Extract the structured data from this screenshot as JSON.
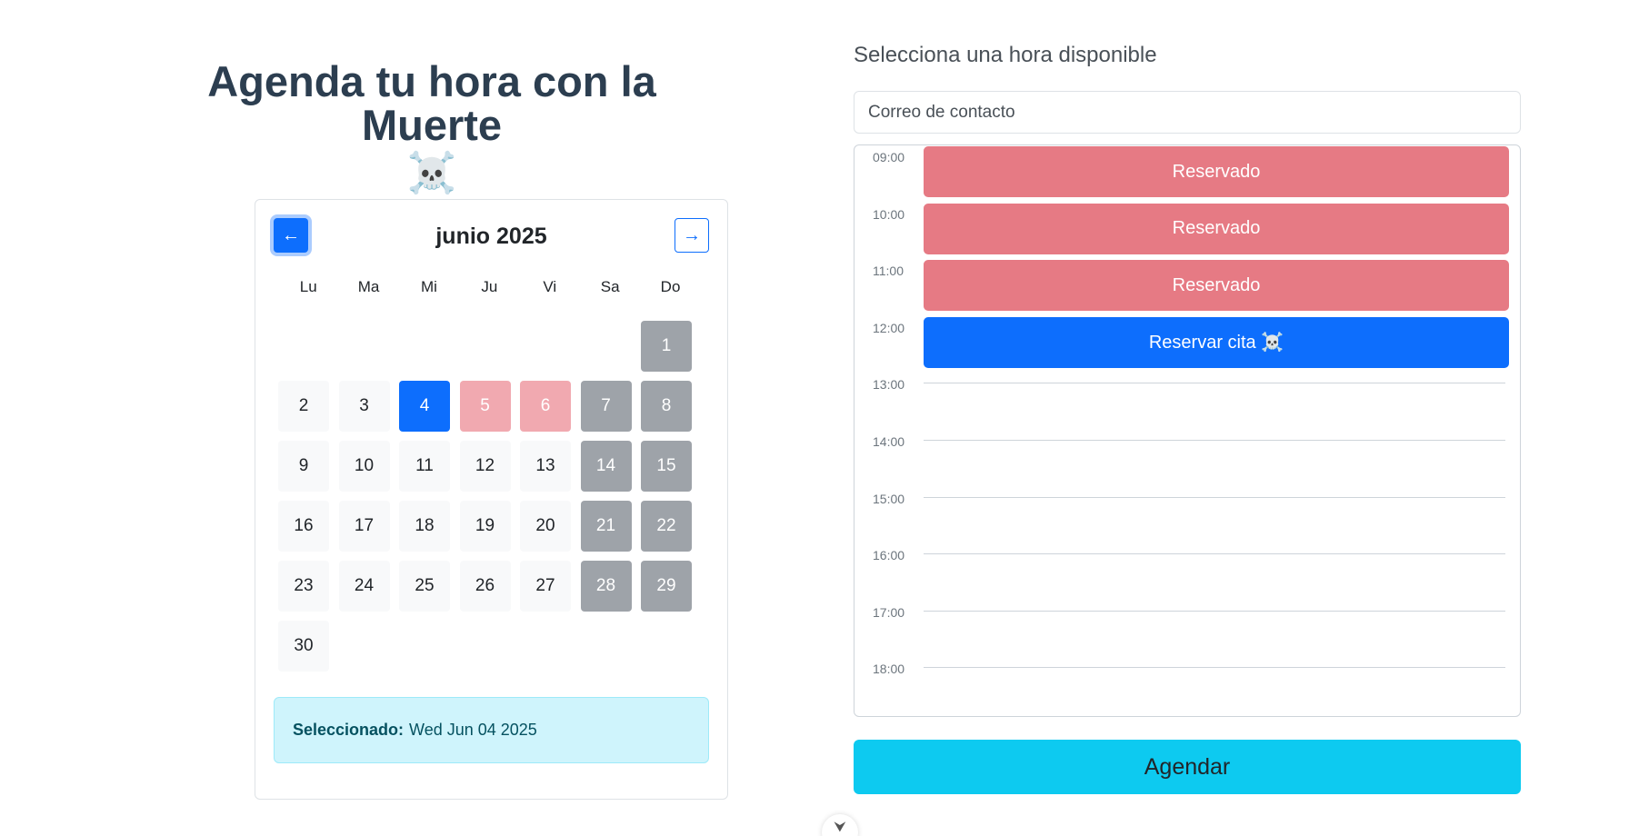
{
  "header": {
    "title": "Agenda tu hora con la Muerte",
    "title_emoji": "☠️"
  },
  "calendar": {
    "prev_label": "←",
    "next_label": "→",
    "month_label": "junio 2025",
    "weekdays": [
      "Lu",
      "Ma",
      "Mi",
      "Ju",
      "Vi",
      "Sa",
      "Do"
    ],
    "leading_empty": 6,
    "days": [
      {
        "n": "1",
        "state": "weekend"
      },
      {
        "n": "2",
        "state": "normal"
      },
      {
        "n": "3",
        "state": "normal"
      },
      {
        "n": "4",
        "state": "selected"
      },
      {
        "n": "5",
        "state": "blocked"
      },
      {
        "n": "6",
        "state": "blocked"
      },
      {
        "n": "7",
        "state": "weekend"
      },
      {
        "n": "8",
        "state": "weekend"
      },
      {
        "n": "9",
        "state": "normal"
      },
      {
        "n": "10",
        "state": "normal"
      },
      {
        "n": "11",
        "state": "normal"
      },
      {
        "n": "12",
        "state": "normal"
      },
      {
        "n": "13",
        "state": "normal"
      },
      {
        "n": "14",
        "state": "weekend"
      },
      {
        "n": "15",
        "state": "weekend"
      },
      {
        "n": "16",
        "state": "normal"
      },
      {
        "n": "17",
        "state": "normal"
      },
      {
        "n": "18",
        "state": "normal"
      },
      {
        "n": "19",
        "state": "normal"
      },
      {
        "n": "20",
        "state": "normal"
      },
      {
        "n": "21",
        "state": "weekend"
      },
      {
        "n": "22",
        "state": "weekend"
      },
      {
        "n": "23",
        "state": "normal"
      },
      {
        "n": "24",
        "state": "normal"
      },
      {
        "n": "25",
        "state": "normal"
      },
      {
        "n": "26",
        "state": "normal"
      },
      {
        "n": "27",
        "state": "normal"
      },
      {
        "n": "28",
        "state": "weekend"
      },
      {
        "n": "29",
        "state": "weekend"
      },
      {
        "n": "30",
        "state": "normal"
      }
    ],
    "selected_label": "Seleccionado:",
    "selected_value": "Wed Jun 04 2025"
  },
  "schedule": {
    "heading": "Selecciona una hora disponible",
    "email_placeholder": "Correo de contacto",
    "hours": [
      {
        "time": "09:00",
        "slot": "booked",
        "label": "Reservado"
      },
      {
        "time": "10:00",
        "slot": "booked",
        "label": "Reservado"
      },
      {
        "time": "11:00",
        "slot": "booked",
        "label": "Reservado"
      },
      {
        "time": "12:00",
        "slot": "available",
        "label": "Reservar cita ☠️"
      },
      {
        "time": "13:00",
        "slot": "",
        "label": ""
      },
      {
        "time": "14:00",
        "slot": "",
        "label": ""
      },
      {
        "time": "15:00",
        "slot": "",
        "label": ""
      },
      {
        "time": "16:00",
        "slot": "",
        "label": ""
      },
      {
        "time": "17:00",
        "slot": "",
        "label": ""
      },
      {
        "time": "18:00",
        "slot": "",
        "label": ""
      }
    ],
    "submit_label": "Agendar"
  },
  "scroll_hint": "⮟",
  "colors": {
    "primary": "#0d6efd",
    "booked": "#e67a84",
    "blocked_day": "#f1a9b0",
    "weekend_day": "#9ea3a9",
    "info": "#0dcaf0",
    "title": "#2c3e50"
  }
}
